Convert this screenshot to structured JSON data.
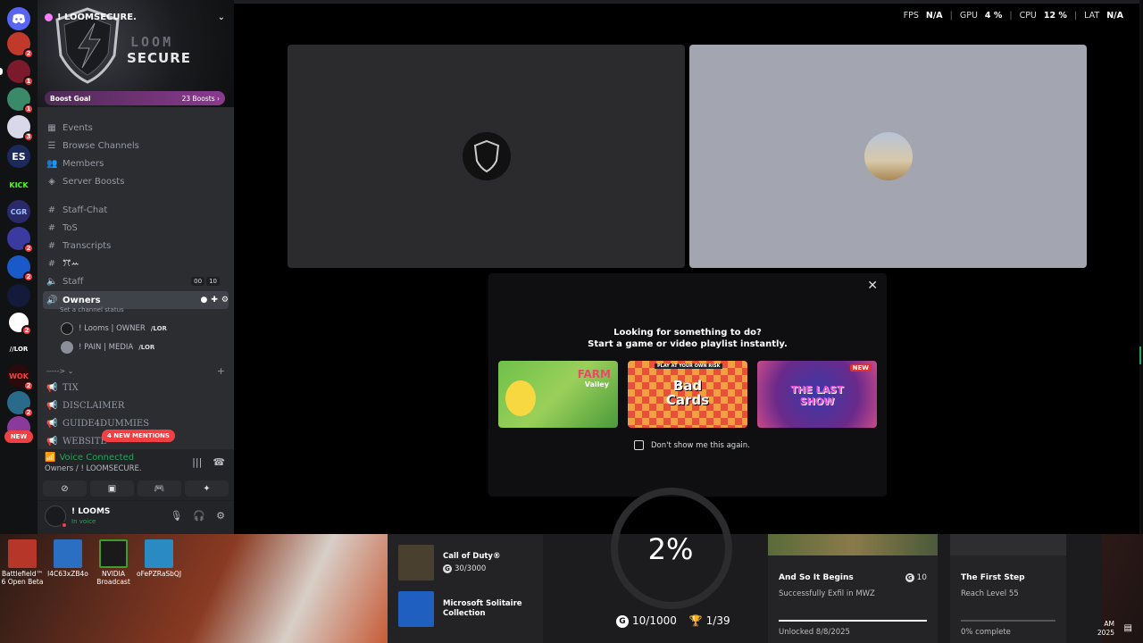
{
  "server": {
    "name": "! LOOMSECURE.",
    "banner_line1": "LOOM",
    "banner_line2": "SECURE",
    "boost_goal_label": "Boost Goal",
    "boosts": "23 Boosts"
  },
  "rail": {
    "badges": [
      "2",
      "1",
      "1",
      "3",
      "2",
      "2",
      "2",
      "2",
      "2"
    ],
    "labels": {
      "es": "ES",
      "kick": "KICK",
      "cgr": "CGR",
      "lor": "//LOR",
      "wok": "WOK",
      "new": "NEW"
    }
  },
  "sidebar": {
    "nav": [
      "Events",
      "Browse Channels",
      "Members",
      "Server Boosts"
    ],
    "channels": {
      "staff_chat": "Staff-Chat",
      "tos": "ToS",
      "transcripts": "Transcripts",
      "symbols": "ꔫꕀ",
      "staff": "Staff",
      "staff_count_a": "00",
      "staff_count_b": "10",
      "owners": "Owners",
      "owners_status": "Set a channel status",
      "category": "-----> ",
      "tix": "TIX",
      "disclaimer": "DISCLAIMER",
      "guide": "GUIDE4DUMMIES",
      "website": "WEBSITE"
    },
    "voice_users": [
      {
        "name": "! Looms | OWNER",
        "tag": "/LOR"
      },
      {
        "name": "! PAIN | MEDIA",
        "tag": "/LOR"
      }
    ],
    "new_mentions": "4 NEW MENTIONS"
  },
  "voice": {
    "status": "Voice Connected",
    "channel": "Owners / ! LOOMSECURE."
  },
  "user": {
    "name": "! LOOMS",
    "status": "In voice"
  },
  "perf": {
    "fps_label": "FPS",
    "fps": "N/A",
    "gpu_label": "GPU",
    "gpu": "4 %",
    "cpu_label": "CPU",
    "cpu": "12 %",
    "lat_label": "LAT",
    "lat": "N/A"
  },
  "activity": {
    "line1": "Looking for something to do?",
    "line2": "Start a game or video playlist instantly.",
    "card1": "FARM",
    "card1_sub": "Valley",
    "card2_top": "PLAY AT YOUR OWN RISK",
    "card2": "Bad Cards",
    "card3": "THE LAST SHOW",
    "card3_badge": "NEW",
    "dont_show": "Don't show me this again."
  },
  "desktop": {
    "icons": [
      {
        "label": "Battlefield™ 6 Open Beta",
        "color": "#b6362a"
      },
      {
        "label": "l4C63xZB4o",
        "color": "#2a6fc2"
      },
      {
        "label": "NVIDIA Broadcast",
        "color": "#3f9b2c"
      },
      {
        "label": "oFePZRaSbQJ",
        "color": "#2a8ac2"
      }
    ]
  },
  "xbox": {
    "games": [
      {
        "name": "Call of Duty®",
        "score": "30/3000",
        "color": "#4a4030"
      },
      {
        "name": "Microsoft Solitaire Collection",
        "score": "",
        "color": "#1f5fbf"
      }
    ],
    "percent": "2%",
    "gamerscore": "10/1000",
    "trophies": "1/39",
    "achievements": [
      {
        "title": "And So It Begins",
        "points": "10",
        "desc": "Successfully Exfil in MWZ",
        "footer": "Unlocked 8/8/2025",
        "progress": 1.0
      },
      {
        "title": "The First Step",
        "points": "",
        "desc": "Reach Level 55",
        "footer": "0% complete",
        "progress": 0.0
      }
    ]
  },
  "tray": {
    "time": "AM",
    "date": "2025"
  }
}
